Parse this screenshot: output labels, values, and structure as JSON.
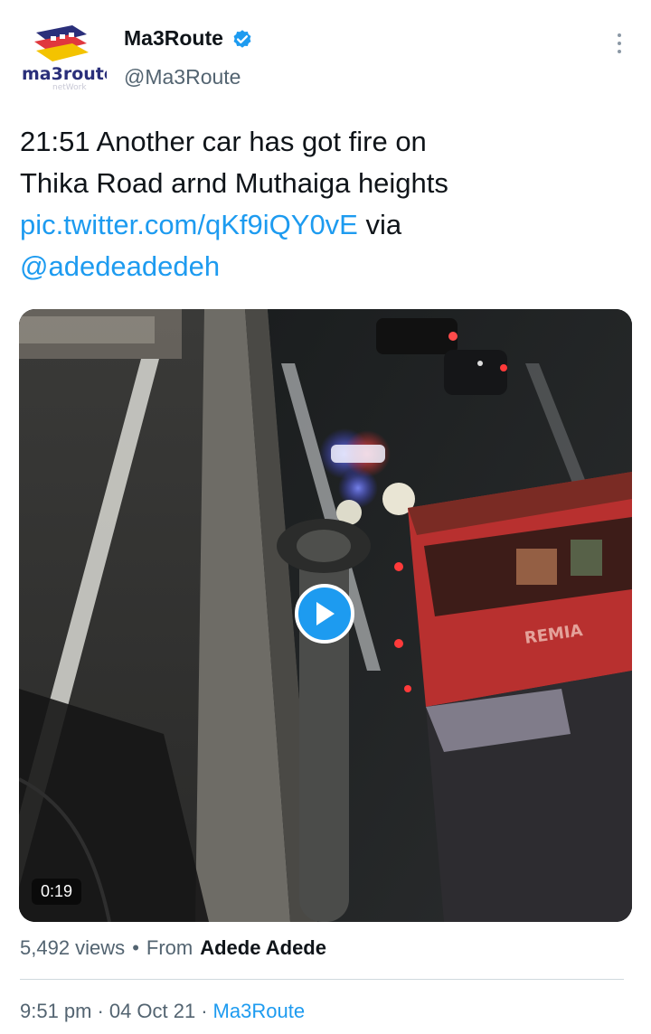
{
  "author": {
    "name": "Ma3Route",
    "handle": "@Ma3Route",
    "verified": true,
    "logo_text": "ma3route"
  },
  "tweet": {
    "text_line1": "21:51 Another car has got fire on",
    "text_line2": "Thika Road arnd Muthaiga heights",
    "link": "pic.twitter.com/qKf9iQY0vE",
    "via": "via",
    "mention": "@adedeadedeh"
  },
  "media": {
    "type": "video",
    "duration": "0:19",
    "bus_text": "REMIA"
  },
  "stats": {
    "views": "5,492 views",
    "separator": "•",
    "from_label": "From",
    "from_user": "Adede Adede"
  },
  "meta": {
    "time": "9:51 pm",
    "dot1": "·",
    "date": "04 Oct 21",
    "dot2": "·",
    "source": "Ma3Route"
  },
  "colors": {
    "link": "#1d9bf0",
    "text": "#0f1419",
    "muted": "#536471",
    "verified": "#1d9bf0"
  }
}
